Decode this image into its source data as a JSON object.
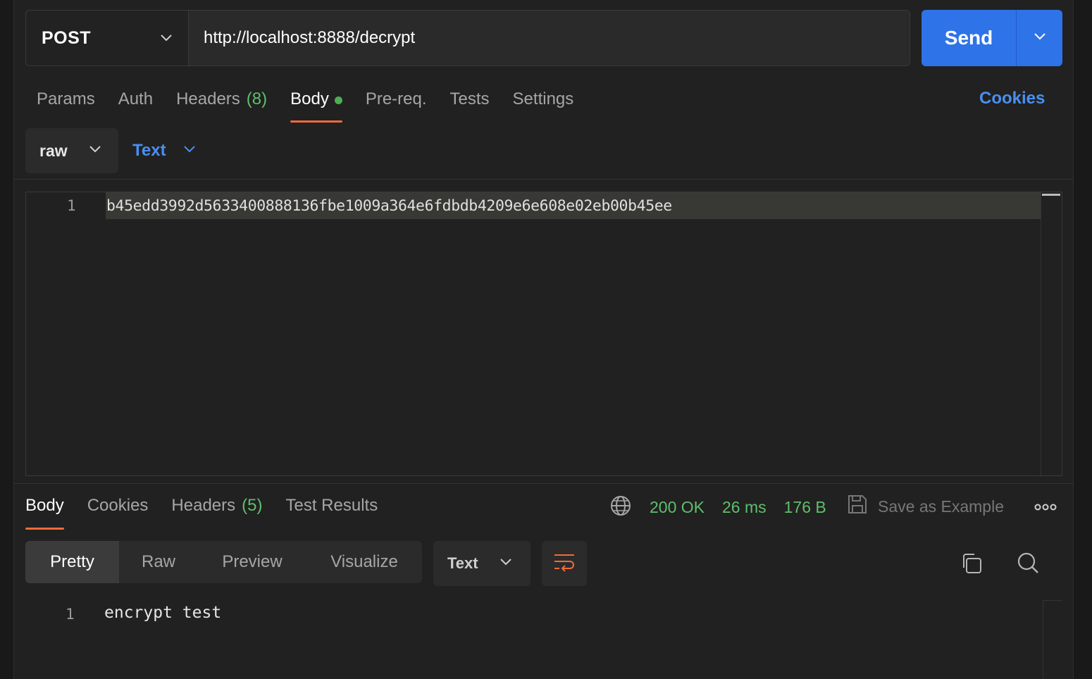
{
  "request": {
    "method": "POST",
    "url": "http://localhost:8888/decrypt",
    "send_label": "Send"
  },
  "request_tabs": {
    "params": "Params",
    "auth": "Auth",
    "headers": "Headers",
    "headers_count": "(8)",
    "body": "Body",
    "prereq": "Pre-req.",
    "tests": "Tests",
    "settings": "Settings",
    "cookies": "Cookies"
  },
  "body_mode": {
    "type": "raw",
    "format": "Text"
  },
  "editor": {
    "line_number": "1",
    "content": "b45edd3992d5633400888136fbe1009a364e6fdbdb4209e6e608e02eb00b45ee"
  },
  "response_tabs": {
    "body": "Body",
    "cookies": "Cookies",
    "headers": "Headers",
    "headers_count": "(5)",
    "test_results": "Test Results"
  },
  "response_status": {
    "status": "200 OK",
    "time": "26 ms",
    "size": "176 B",
    "save_example": "Save as Example",
    "color": "#5fbf6c"
  },
  "response_view": {
    "modes": [
      "Pretty",
      "Raw",
      "Preview",
      "Visualize"
    ],
    "active_mode": "Pretty",
    "format": "Text"
  },
  "response_body": {
    "line_number": "1",
    "content": "encrypt test"
  },
  "colors": {
    "accent_blue": "#2e73e8",
    "link_blue": "#4a8ff0",
    "active_tab_underline": "#f26b3a",
    "success_green": "#5fbf6c"
  }
}
